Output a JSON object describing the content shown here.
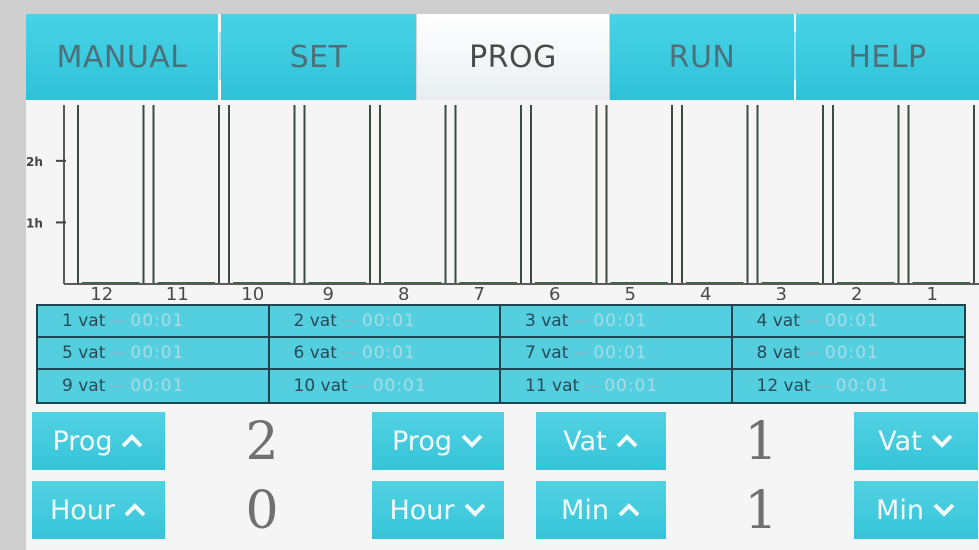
{
  "tabs": [
    {
      "label": "MANUAL",
      "active": false
    },
    {
      "label": "SET",
      "active": false
    },
    {
      "label": "PROG",
      "active": true
    },
    {
      "label": "RUN",
      "active": false
    },
    {
      "label": "HELP",
      "active": false
    }
  ],
  "chart_data": {
    "type": "bar",
    "categories": [
      "12",
      "11",
      "10",
      "9",
      "8",
      "7",
      "6",
      "5",
      "4",
      "3",
      "2",
      "1"
    ],
    "values": [
      0.02,
      0.02,
      0.02,
      0.02,
      0.02,
      0.02,
      0.02,
      0.02,
      0.02,
      0.02,
      0.02,
      0.02
    ],
    "y_tick_labels": [
      "2h",
      "1h"
    ],
    "y_ticks_hours": [
      2,
      1
    ],
    "ylim": [
      0,
      2.5
    ]
  },
  "vats": [
    {
      "label": "1 vat",
      "time": "00:01"
    },
    {
      "label": "2 vat",
      "time": "00:01"
    },
    {
      "label": "3 vat",
      "time": "00:01"
    },
    {
      "label": "4 vat",
      "time": "00:01"
    },
    {
      "label": "5 vat",
      "time": "00:01"
    },
    {
      "label": "6 vat",
      "time": "00:01"
    },
    {
      "label": "7 vat",
      "time": "00:01"
    },
    {
      "label": "8 vat",
      "time": "00:01"
    },
    {
      "label": "9 vat",
      "time": "00:01"
    },
    {
      "label": "10 vat",
      "time": "00:01"
    },
    {
      "label": "11 vat",
      "time": "00:01"
    },
    {
      "label": "12 vat",
      "time": "00:01"
    }
  ],
  "dash": "—",
  "controls": {
    "prog_up": "Prog",
    "prog_down": "Prog",
    "prog_value": "2",
    "vat_up": "Vat",
    "vat_down": "Vat",
    "vat_value": "1",
    "hour_up": "Hour",
    "hour_down": "Hour",
    "hour_value": "0",
    "min_up": "Min",
    "min_down": "Min",
    "min_value": "1"
  },
  "icons": {
    "up": "chevron-up-icon",
    "down": "chevron-down-icon"
  },
  "colors": {
    "accent": "#3cc8dc",
    "grid_line": "#1c4550",
    "bar_line": "#3d4a42"
  }
}
